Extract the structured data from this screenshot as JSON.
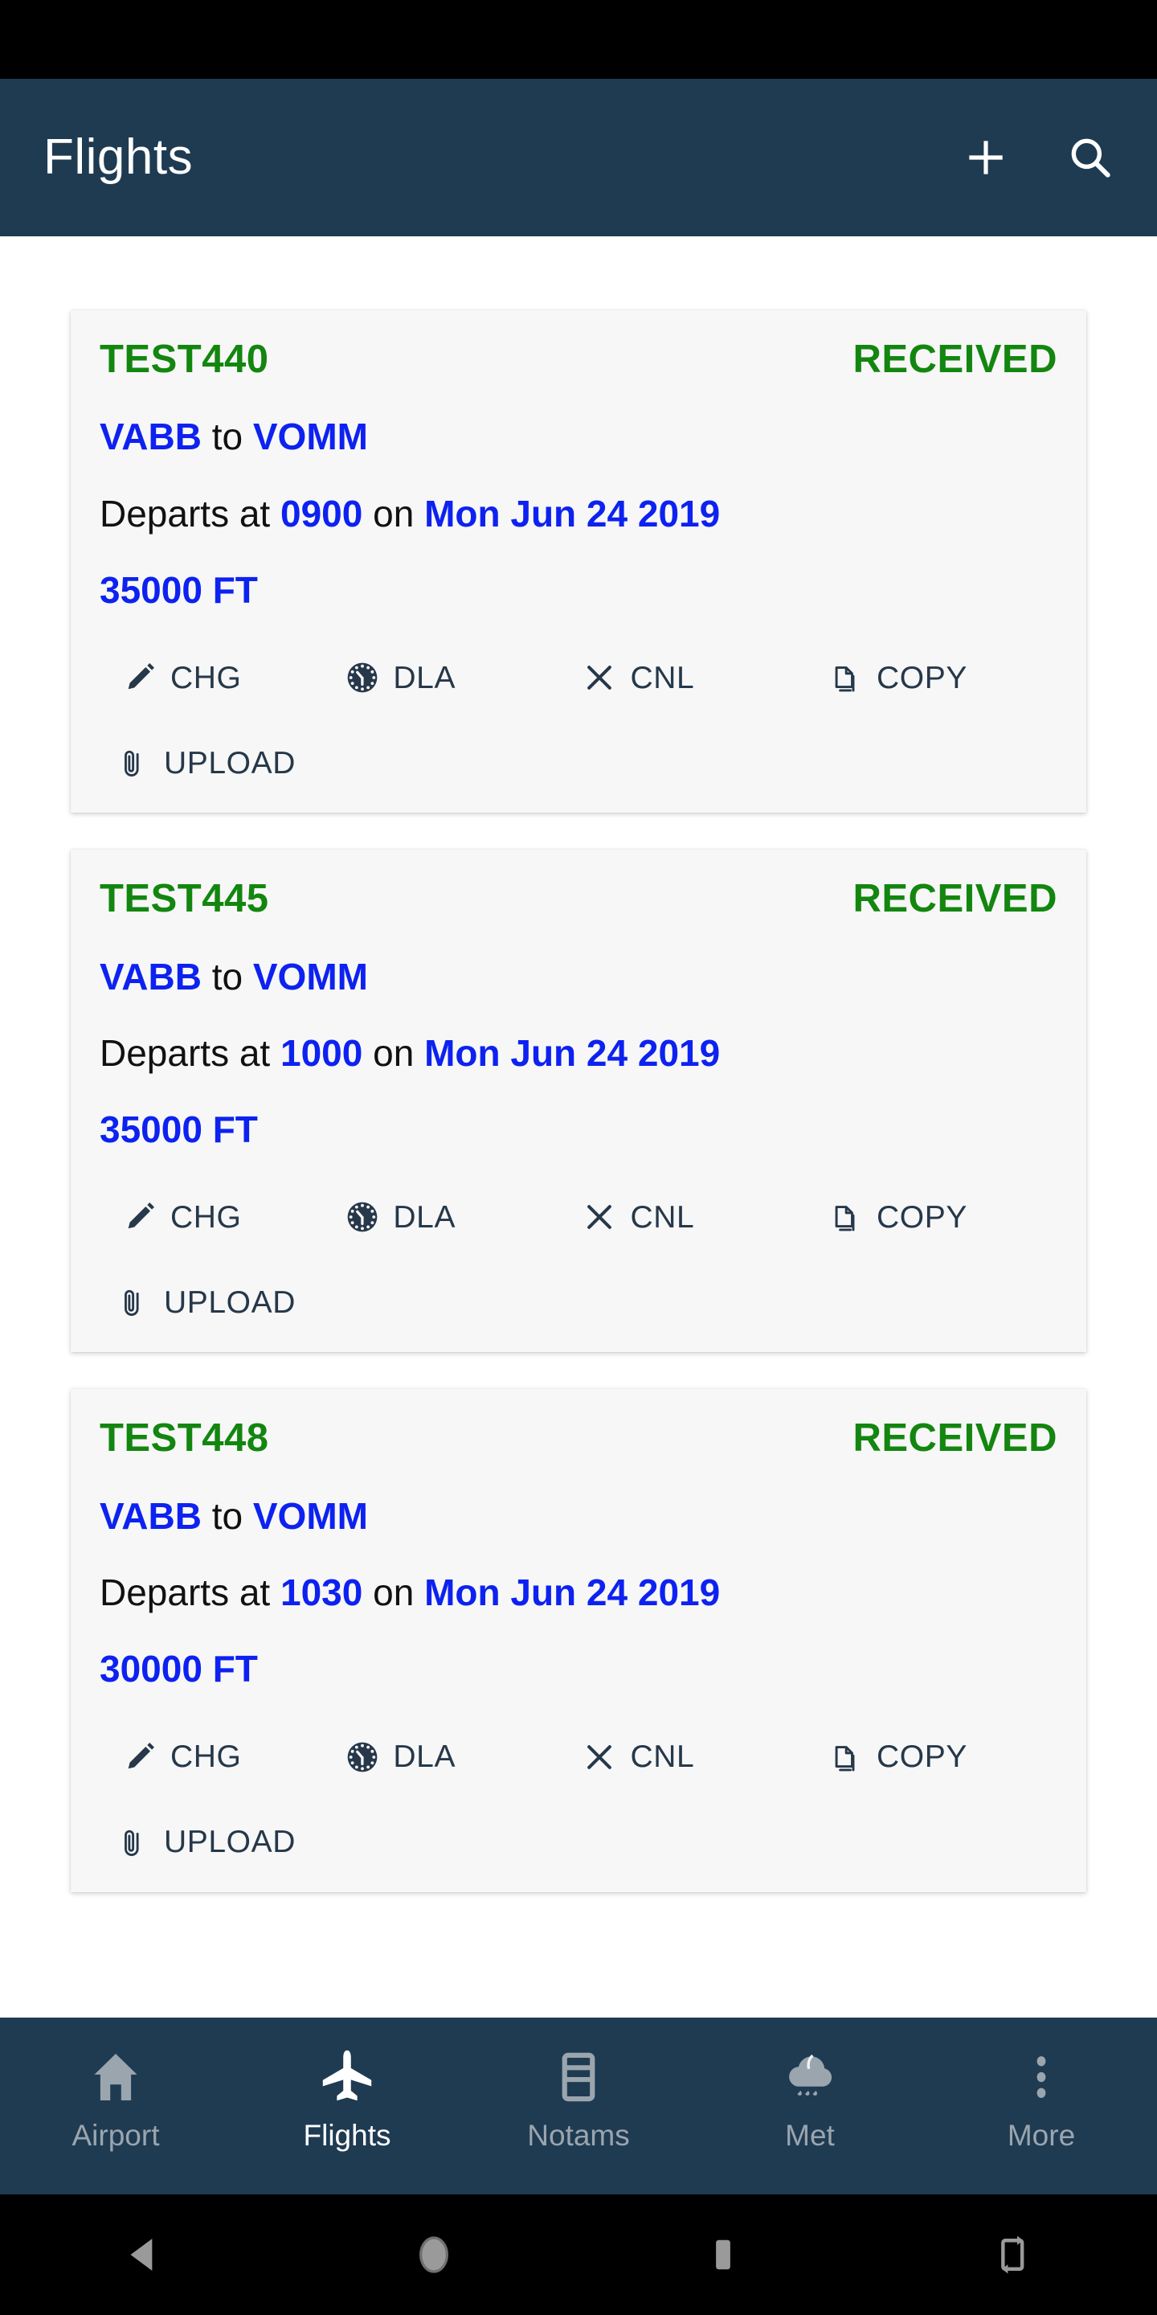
{
  "theme": {
    "app_bar_color": "#1f3b52",
    "status_bar_color": "#000000",
    "page_background": "#ffffff",
    "card_background": "#f7f7f7",
    "accent_green": "#13860f",
    "accent_blue": "#0d22f0",
    "icon_navy": "#1f3b52",
    "nav_inactive": "#9aa5ae",
    "nav_active": "#ffffff"
  },
  "app_bar": {
    "title": "Flights",
    "actions": [
      {
        "name": "add-flight-button",
        "icon": "plus-icon",
        "label": "+"
      },
      {
        "name": "search-button",
        "icon": "search-icon",
        "label": "Search"
      }
    ]
  },
  "flights": [
    {
      "id": "TEST440",
      "status": "RECEIVED",
      "origin": "VABB",
      "to_word": "to",
      "destination": "VOMM",
      "departs_prefix": "Departs at",
      "departs_time": "0900",
      "on_word": "on",
      "departs_date": "Mon Jun 24 2019",
      "level": "35000 FT",
      "actions": [
        {
          "label": "CHG",
          "icon": "pencil-icon"
        },
        {
          "label": "DLA",
          "icon": "clock-icon"
        },
        {
          "label": "CNL",
          "icon": "close-x-icon"
        },
        {
          "label": "COPY",
          "icon": "copy-icon"
        },
        {
          "label": "UPLOAD",
          "icon": "paperclip-icon"
        }
      ]
    },
    {
      "id": "TEST445",
      "status": "RECEIVED",
      "origin": "VABB",
      "to_word": "to",
      "destination": "VOMM",
      "departs_prefix": "Departs at",
      "departs_time": "1000",
      "on_word": "on",
      "departs_date": "Mon Jun 24 2019",
      "level": "35000 FT",
      "actions": [
        {
          "label": "CHG",
          "icon": "pencil-icon"
        },
        {
          "label": "DLA",
          "icon": "clock-icon"
        },
        {
          "label": "CNL",
          "icon": "close-x-icon"
        },
        {
          "label": "COPY",
          "icon": "copy-icon"
        },
        {
          "label": "UPLOAD",
          "icon": "paperclip-icon"
        }
      ]
    },
    {
      "id": "TEST448",
      "status": "RECEIVED",
      "origin": "VABB",
      "to_word": "to",
      "destination": "VOMM",
      "departs_prefix": "Departs at",
      "departs_time": "1030",
      "on_word": "on",
      "departs_date": "Mon Jun 24 2019",
      "level": "30000 FT",
      "actions": [
        {
          "label": "CHG",
          "icon": "pencil-icon"
        },
        {
          "label": "DLA",
          "icon": "clock-icon"
        },
        {
          "label": "CNL",
          "icon": "close-x-icon"
        },
        {
          "label": "COPY",
          "icon": "copy-icon"
        },
        {
          "label": "UPLOAD",
          "icon": "paperclip-icon"
        }
      ]
    }
  ],
  "bottom_nav": {
    "items": [
      {
        "label": "Airport",
        "icon": "home-icon",
        "active": false
      },
      {
        "label": "Flights",
        "icon": "airplane-icon",
        "active": true
      },
      {
        "label": "Notams",
        "icon": "card-list-icon",
        "active": false
      },
      {
        "label": "Met",
        "icon": "rain-cloud-icon",
        "active": false
      },
      {
        "label": "More",
        "icon": "dots-vertical-icon",
        "active": false
      }
    ]
  },
  "system_nav": {
    "buttons": [
      {
        "label": "Back",
        "icon": "triangle-back-icon"
      },
      {
        "label": "Home",
        "icon": "circle-home-icon"
      },
      {
        "label": "Recents",
        "icon": "square-recents-icon"
      },
      {
        "label": "Rotate",
        "icon": "rotate-screen-icon"
      }
    ]
  }
}
